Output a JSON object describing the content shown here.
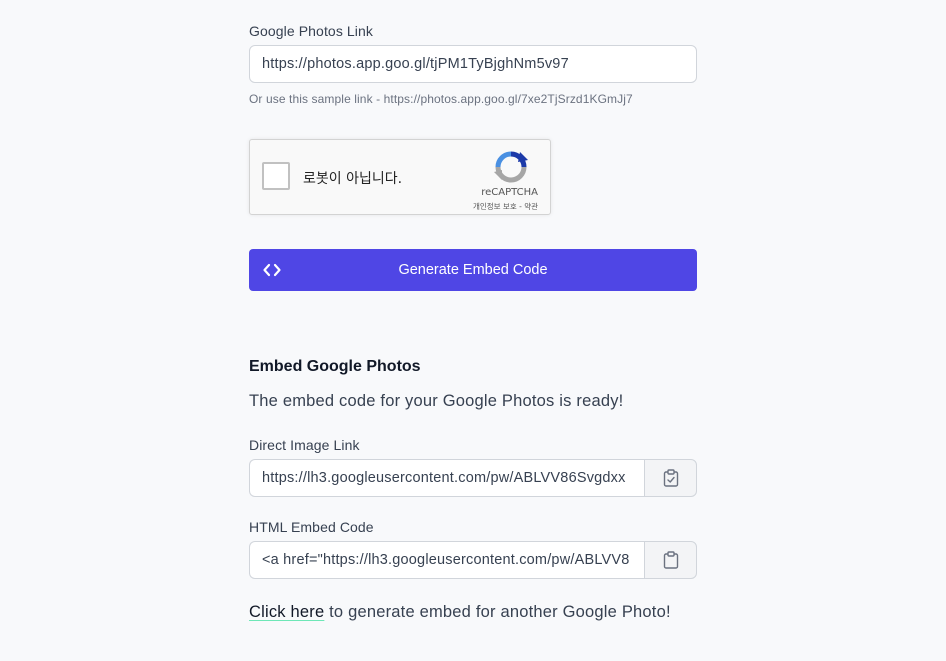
{
  "form": {
    "link_label": "Google Photos Link",
    "link_value": "https://photos.app.goo.gl/tjPM1TyBjghNm5v97",
    "hint": "Or use this sample link - https://photos.app.goo.gl/7xe2TjSrzd1KGmJj7"
  },
  "recaptcha": {
    "label": "로봇이 아닙니다.",
    "brand": "reCAPTCHA",
    "terms": "개인정보 보호 - 약관"
  },
  "generate_button": {
    "label": "Generate Embed Code",
    "icon": "code-icon",
    "color": "#4f46e5"
  },
  "result": {
    "title": "Embed Google Photos",
    "message": "The embed code for your Google Photos is ready!",
    "direct_link_label": "Direct Image Link",
    "direct_link_value": "https://lh3.googleusercontent.com/pw/ABLVV86Svgdxx",
    "html_code_label": "HTML Embed Code",
    "html_code_value": "<a href=\"https://lh3.googleusercontent.com/pw/ABLVV8",
    "copy_icon_checked": "clipboard-check-icon",
    "copy_icon": "clipboard-icon"
  },
  "footer": {
    "link_text": "Click here",
    "rest_text": " to generate embed for another Google Photo!"
  }
}
